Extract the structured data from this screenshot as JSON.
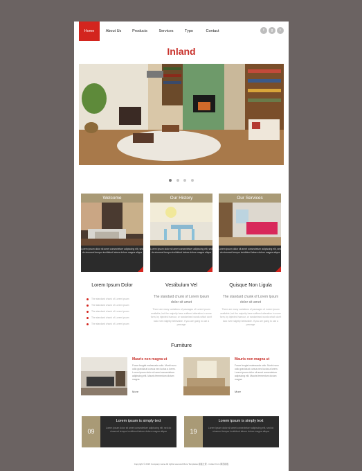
{
  "nav": {
    "items": [
      {
        "label": "Home",
        "active": true
      },
      {
        "label": "About Us",
        "active": false
      },
      {
        "label": "Products",
        "active": false
      },
      {
        "label": "Services",
        "active": false
      },
      {
        "label": "Typo",
        "active": false
      },
      {
        "label": "Contact",
        "active": false
      }
    ],
    "social": [
      "f",
      "g",
      "t"
    ]
  },
  "logo": "Inland",
  "slider": {
    "dots": 4,
    "active": 1
  },
  "features": [
    {
      "title": "Welcome",
      "text": "Lorem ipsum dolor sit amet consectetuer adipiscing elit, sed do eiusmod tempor incididunt labore dolore magna aliqua"
    },
    {
      "title": "Our History",
      "text": "Lorem ipsum dolor sit amet consectetuer adipiscing elit, sed do eiusmod tempor incididunt labore dolore magna aliqua"
    },
    {
      "title": "Our Services",
      "text": "Lorem ipsum dolor sit amet consectetuer adipiscing elit, sed do eiusmod tempor incididunt labore dolore magna aliqua"
    }
  ],
  "columns": {
    "left": {
      "title": "Lorem Ipsum Dolor",
      "items": [
        "The standard chunk of Lorem Ipsum",
        "The standard chunk of Lorem Ipsum",
        "The standard chunk of Lorem Ipsum",
        "The standard chunk of Lorem Ipsum",
        "The standard chunk of Lorem Ipsum"
      ]
    },
    "middle": {
      "title": "Vestibulum Vel",
      "subtitle": "The standard chunk of Lorem Ipsum dolor sit amet",
      "body": "There are many variations of passages of Lorem Ipsum available, but the majority have suffered alteration in some form, by injected humour, or randomised words which don't look even slightly believable. If you are going to use a passage"
    },
    "right": {
      "title": "Quisque Non Ligula",
      "subtitle": "The standard chunk of Lorem Ipsum dolor sit amet",
      "body": "There are many variations of passages of Lorem Ipsum available, but the majority have suffered alteration in some form, by injected humour, or randomised words which don't look even slightly believable. If you are going to use a passage"
    }
  },
  "furniture": {
    "title": "Furniture",
    "items": [
      {
        "title": "Mauris non magna ut",
        "body": "Fusce feugiat malesuada odio. Morbi nunc odio gravida at cursus nec luctus a lorem. Lorem ipsum dolor sit amet consectetuer adipiscing elit. Mauris fermentum dictum magna.",
        "more": "More"
      },
      {
        "title": "Mauris non magna ut",
        "body": "Fusce feugiat malesuada odio. Morbi nunc odio gravida at cursus nec luctus a lorem. Lorem ipsum dolor sit amet consectetuer adipiscing elit. Mauris fermentum dictum magna.",
        "more": "More"
      }
    ]
  },
  "bottom": [
    {
      "num": "09",
      "title": "Lorem ipsum is simply text",
      "body": "Lorem ipsum dolor sit amet consectetuer adipiscing elit, sed do eiusmod tempor incididunt labore dolore magna aliqua"
    },
    {
      "num": "19",
      "title": "Lorem ipsum is simply text",
      "body": "Lorem ipsum dolor sit amet consectetuer adipiscing elit, sed do eiusmod tempor incididunt labore dolore magna aliqua"
    }
  ],
  "footer": "Copyright © 2015 Company name All rights reserved More Templates 模板之家 - Collect from 网页模板",
  "colors": {
    "accent": "#d3251e",
    "gold": "#a99a76",
    "dark": "#2b2b2b",
    "background": "#6b6362"
  }
}
